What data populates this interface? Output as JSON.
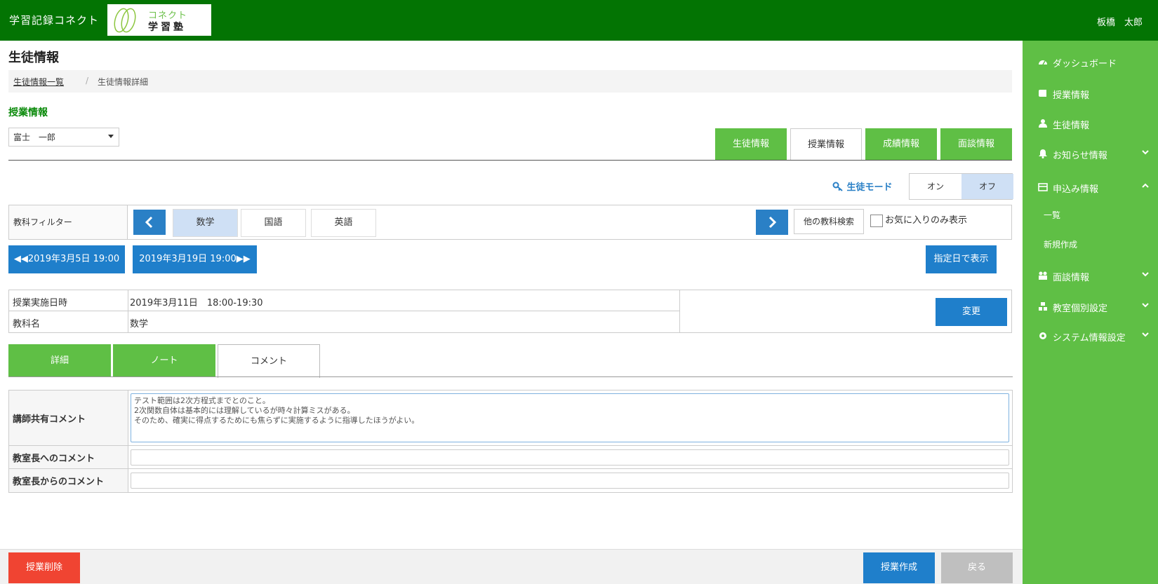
{
  "header": {
    "app_title": "学習記録コネクト",
    "logo_top": "コネクト",
    "logo_bottom": "学習塾",
    "user_name": "板橋　太郎"
  },
  "sidebar": {
    "items": [
      {
        "label": "ダッシュボード",
        "icon": "dashboard-icon"
      },
      {
        "label": "授業情報",
        "icon": "book-icon"
      },
      {
        "label": "生徒情報",
        "icon": "user-icon"
      },
      {
        "label": "お知らせ情報",
        "icon": "bell-icon",
        "chevron": "down"
      },
      {
        "label": "申込み情報",
        "icon": "card-icon",
        "chevron": "up"
      },
      {
        "label": "面談情報",
        "icon": "people-icon",
        "chevron": "down"
      },
      {
        "label": "教室個別設定",
        "icon": "cubes-icon",
        "chevron": "down"
      },
      {
        "label": "システム情報設定",
        "icon": "gear-icon",
        "chevron": "down"
      }
    ],
    "sub_items": [
      "一覧",
      "新規作成"
    ]
  },
  "page": {
    "title": "生徒情報",
    "breadcrumb": {
      "link": "生徒情報一覧",
      "separator": "/",
      "current": "生徒情報詳細"
    },
    "section_title": "授業情報",
    "student_select": "富士　一郎"
  },
  "top_tabs": [
    "生徒情報",
    "授業情報",
    "成績情報",
    "面談情報"
  ],
  "student_mode": {
    "label": "生徒モード",
    "on": "オン",
    "off": "オフ",
    "selected": "オフ"
  },
  "filter": {
    "label": "教科フィルター",
    "subjects": [
      "数学",
      "国語",
      "英語"
    ],
    "selected": "数学",
    "other_search": "他の教科検索",
    "favorites_only": "お気に入りのみ表示"
  },
  "date_nav": {
    "prev": "◀◀2019年3月5日 19:00",
    "next": "2019年3月19日 19:00▶▶",
    "by_date": "指定日で表示"
  },
  "lesson_info": {
    "rows": [
      {
        "key": "授業実施日時",
        "value": "2019年3月11日　18:00-19:30"
      },
      {
        "key": "教科名",
        "value": "数学"
      }
    ],
    "change_button": "変更"
  },
  "content_tabs": [
    "詳細",
    "ノート",
    "コメント"
  ],
  "comments": {
    "teacher_shared": {
      "label": "講師共有コメント",
      "lines": [
        "テスト範囲は2次方程式までとのこと。",
        "2次関数自体は基本的には理解しているが時々計算ミスがある。",
        "そのため、確実に得点するためにも焦らずに実施するように指導したほうがよい。"
      ]
    },
    "to_head": {
      "label": "教室長へのコメント",
      "value": ""
    },
    "from_head": {
      "label": "教室長からのコメント",
      "value": ""
    }
  },
  "footer": {
    "delete": "授業削除",
    "create": "授業作成",
    "back": "戻る"
  },
  "colors": {
    "header": "#037403",
    "sidebar": "#5fbf45",
    "primary": "#1f7fcb",
    "danger": "#f04432",
    "disabled": "#bfbfbf"
  }
}
